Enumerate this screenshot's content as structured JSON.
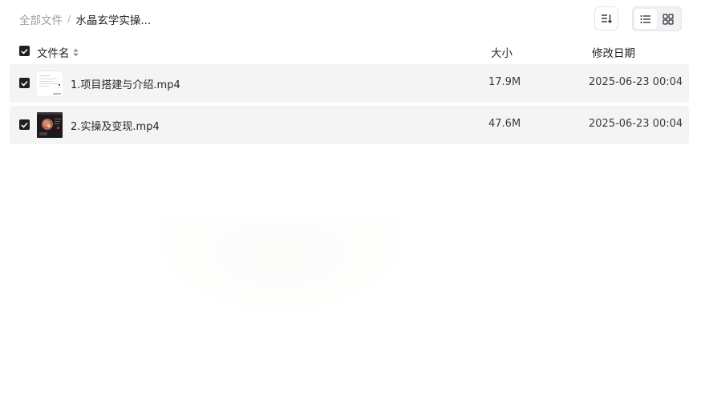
{
  "breadcrumb": {
    "root": "全部文件",
    "separator": "/",
    "current": "水晶玄学实操..."
  },
  "toolbar": {
    "sort_icon": "sort-order-icon",
    "view_list_icon": "list-view-icon",
    "view_grid_icon": "grid-view-icon",
    "active_view": "list"
  },
  "table": {
    "headers": {
      "name": "文件名",
      "size": "大小",
      "date": "修改日期"
    },
    "select_all_checked": true,
    "rows": [
      {
        "name": "1.项目搭建与介绍.mp4",
        "size": "17.9M",
        "date": "2025-06-23 00:04",
        "checked": true,
        "thumb": "document-preview-thumbnail"
      },
      {
        "name": "2.实操及变现.mp4",
        "size": "47.6M",
        "date": "2025-06-23 00:04",
        "checked": true,
        "thumb": "video-preview-thumbnail"
      }
    ]
  },
  "colors": {
    "row_background": "#f4f4f5",
    "checkbox": "#1f2024",
    "muted_text": "#9a9ca3"
  }
}
